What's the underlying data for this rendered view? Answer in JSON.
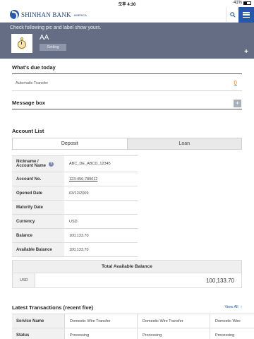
{
  "statusbar": {
    "time": "오후 4:30",
    "battery": "41%"
  },
  "header": {
    "brand": "SHINHAN BANK",
    "brand_sub": "AMERICA",
    "search_icon": "search-icon",
    "menu_icon": "hamburger-menu-icon"
  },
  "profile": {
    "hint": "Check following pic and label show yours.",
    "name": "AA",
    "setting_label": "Setting",
    "expand_label": "+"
  },
  "due": {
    "title": "What's due today",
    "item_label": "Automatic Transfer",
    "item_count": "0"
  },
  "message_box": {
    "title": "Message box",
    "expand_label": "+"
  },
  "account_list": {
    "title": "Account List",
    "tabs": [
      {
        "label": "Deposit",
        "active": true
      },
      {
        "label": "Loan",
        "active": false
      }
    ],
    "rows": [
      {
        "key": "Nickname / Account Name",
        "value": "ABC_DE_ABCD_12345"
      },
      {
        "key": "Account No.",
        "value": "123-456-789012"
      },
      {
        "key": "Opened Date",
        "value": "03/12/2009"
      },
      {
        "key": "Maturity Date",
        "value": ""
      },
      {
        "key": "Currency",
        "value": "USD"
      },
      {
        "key": "Balance",
        "value": "100,133.70"
      },
      {
        "key": "Available Balance",
        "value": "100,133.70"
      }
    ],
    "help_mark": "?"
  },
  "total_balance": {
    "header": "Total Available Balance",
    "currency": "USD",
    "amount": "100,133.70"
  },
  "transactions": {
    "title": "Latest Transactions (recent five)",
    "view_all": "View All",
    "rows": [
      {
        "key": "Service Name",
        "cells": [
          "Domestic Wire Transfer",
          "Domestic Wire Transfer",
          "Domestic Wire"
        ]
      },
      {
        "key": "Status",
        "cells": [
          "Processing",
          "Processing",
          "Processing"
        ]
      }
    ]
  },
  "colors": {
    "header_bar": "#646d83",
    "brand_blue": "#2359a8",
    "accent_orange": "#e08a2b"
  }
}
